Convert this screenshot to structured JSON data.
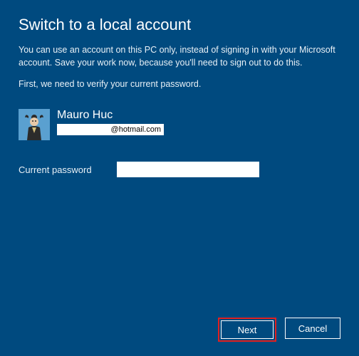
{
  "title": "Switch to a local account",
  "description": "You can use an account on this PC only, instead of signing in with your Microsoft account. Save your work now, because you'll need to sign out to do this.",
  "verify_text": "First, we need to verify your current password.",
  "user": {
    "name": "Mauro Huc",
    "email_domain": "@hotmail.com"
  },
  "field": {
    "password_label": "Current password",
    "password_value": ""
  },
  "buttons": {
    "next": "Next",
    "cancel": "Cancel"
  }
}
